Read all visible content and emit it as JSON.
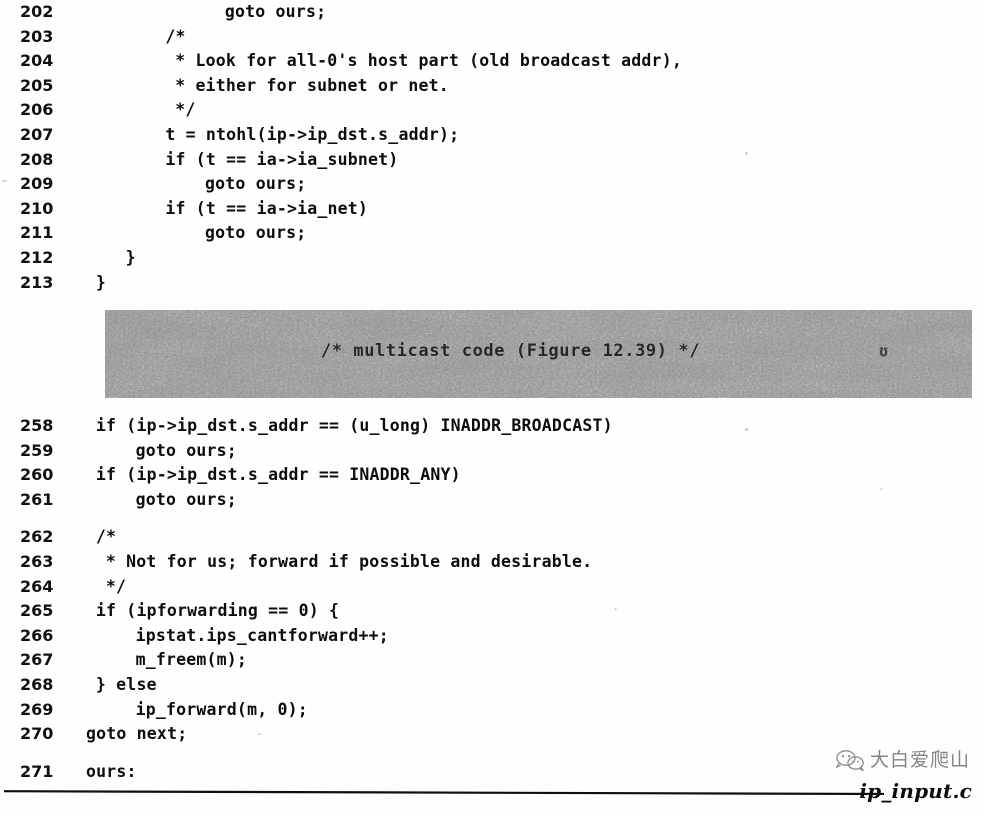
{
  "document": {
    "kind": "scanned-book-page",
    "file_caption": "ip_input.c",
    "background_color": "#ffffff",
    "text_color": "#101010"
  },
  "watermark": {
    "text": "大白爱爬山",
    "icon": "wechat-logo-icon",
    "color": "#3b3b3b"
  },
  "redaction_band": {
    "name": "multicast-code-band",
    "text": "/* multicast code (Figure 12.39) */",
    "trailing_glyph": "ʊ",
    "fill_color": "#8c8c8c"
  },
  "listing_top": {
    "name": "code-block-202-213",
    "lines": [
      {
        "no": "202",
        "indent": 14,
        "text": "goto ours;"
      },
      {
        "no": "203",
        "indent": 8,
        "text": "/*"
      },
      {
        "no": "204",
        "indent": 9,
        "text": "* Look for all-0's host part (old broadcast addr),"
      },
      {
        "no": "205",
        "indent": 9,
        "text": "* either for subnet or net."
      },
      {
        "no": "206",
        "indent": 9,
        "text": "*/"
      },
      {
        "no": "207",
        "indent": 8,
        "text": "t = ntohl(ip->ip_dst.s_addr);"
      },
      {
        "no": "208",
        "indent": 8,
        "text": "if (t == ia->ia_subnet)"
      },
      {
        "no": "209",
        "indent": 12,
        "text": "goto ours;"
      },
      {
        "no": "210",
        "indent": 8,
        "text": "if (t == ia->ia_net)"
      },
      {
        "no": "211",
        "indent": 12,
        "text": "goto ours;"
      },
      {
        "no": "212",
        "indent": 4,
        "text": "}"
      },
      {
        "no": "213",
        "indent": 1,
        "text": "}"
      }
    ]
  },
  "listing_bottom": {
    "name": "code-block-258-271",
    "lines": [
      {
        "no": "258",
        "indent": 1,
        "text": "if (ip->ip_dst.s_addr == (u_long) INADDR_BROADCAST)",
        "gap": false
      },
      {
        "no": "259",
        "indent": 5,
        "text": "goto ours;",
        "gap": false
      },
      {
        "no": "260",
        "indent": 1,
        "text": "if (ip->ip_dst.s_addr == INADDR_ANY)",
        "gap": false
      },
      {
        "no": "261",
        "indent": 5,
        "text": "goto ours;",
        "gap": false
      },
      {
        "no": "262",
        "indent": 1,
        "text": "/*",
        "gap": true
      },
      {
        "no": "263",
        "indent": 2,
        "text": "* Not for us; forward if possible and desirable.",
        "gap": false
      },
      {
        "no": "264",
        "indent": 2,
        "text": "*/",
        "gap": false
      },
      {
        "no": "265",
        "indent": 1,
        "text": "if (ipforwarding == 0) {",
        "gap": false
      },
      {
        "no": "266",
        "indent": 5,
        "text": "ipstat.ips_cantforward++;",
        "gap": false
      },
      {
        "no": "267",
        "indent": 5,
        "text": "m_freem(m);",
        "gap": false
      },
      {
        "no": "268",
        "indent": 1,
        "text": "} else",
        "gap": false
      },
      {
        "no": "269",
        "indent": 5,
        "text": "ip_forward(m, 0);",
        "gap": false
      },
      {
        "no": "270",
        "indent": 0,
        "text": "goto next;",
        "gap": false
      },
      {
        "no": "271",
        "indent": 0,
        "text": "ours:",
        "gap": true
      }
    ]
  }
}
